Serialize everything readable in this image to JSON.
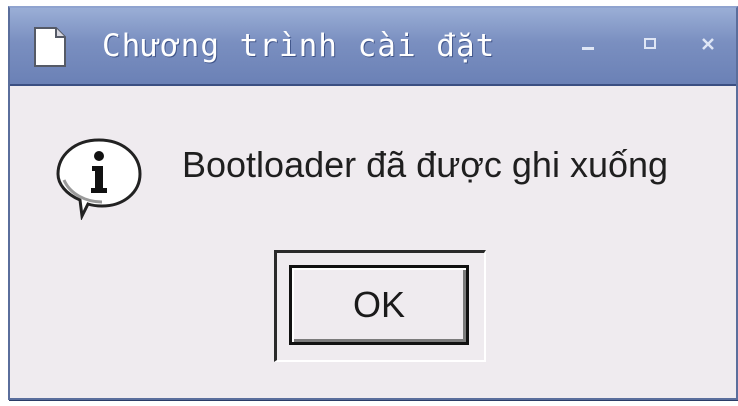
{
  "window": {
    "title": "Chương trình cài đặt",
    "controls": [
      "minimize-icon",
      "maximize-icon",
      "close-icon"
    ]
  },
  "dialog": {
    "icon": "info-icon",
    "message": "Bootloader đã được ghi xuống",
    "ok_label": "OK"
  },
  "colors": {
    "titlebar": "#7a8fc0",
    "background": "#efebef",
    "text": "#1f1f1f"
  }
}
